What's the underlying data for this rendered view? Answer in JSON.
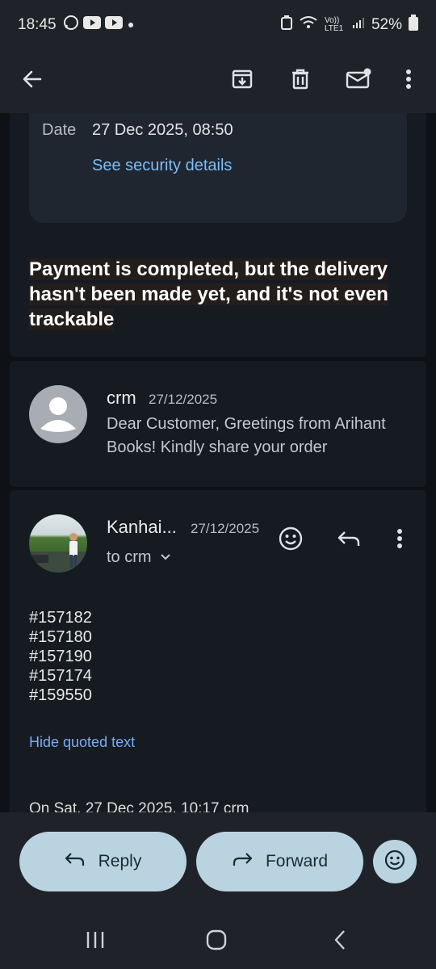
{
  "status_bar": {
    "time": "18:45",
    "battery": "52%",
    "network": "Vo)) LTE1"
  },
  "message_details": {
    "date_label": "Date",
    "date_value": "27 Dec 2025, 08:50",
    "security_link": "See security details"
  },
  "subject": "Payment is completed, but the delivery hasn't been made yet, and it's not even trackable",
  "collapsed_message": {
    "sender": "crm",
    "date": "27/12/2025",
    "snippet": "Dear Customer, Greetings from Arihant Books! Kindly share your order"
  },
  "expanded_message": {
    "sender": "Kanhai...",
    "date": "27/12/2025",
    "recipient": "to crm",
    "body_lines": [
      "#157182",
      "#157180",
      "#157190",
      "#157174",
      "#159550"
    ],
    "hide_quoted": "Hide quoted text",
    "quoted_peek": "On Sat, 27 Dec 2025, 10:17 crm"
  },
  "actions": {
    "reply": "Reply",
    "forward": "Forward"
  },
  "colors": {
    "link": "#7cbdf5",
    "pill": "#b9d4e0",
    "background": "#0e1115"
  },
  "icons": [
    "back-icon",
    "archive-icon",
    "delete-icon",
    "mark-unread-icon",
    "more-icon",
    "emoji-icon",
    "reply-icon",
    "forward-icon",
    "recents-icon",
    "home-icon",
    "nav-back-icon"
  ]
}
